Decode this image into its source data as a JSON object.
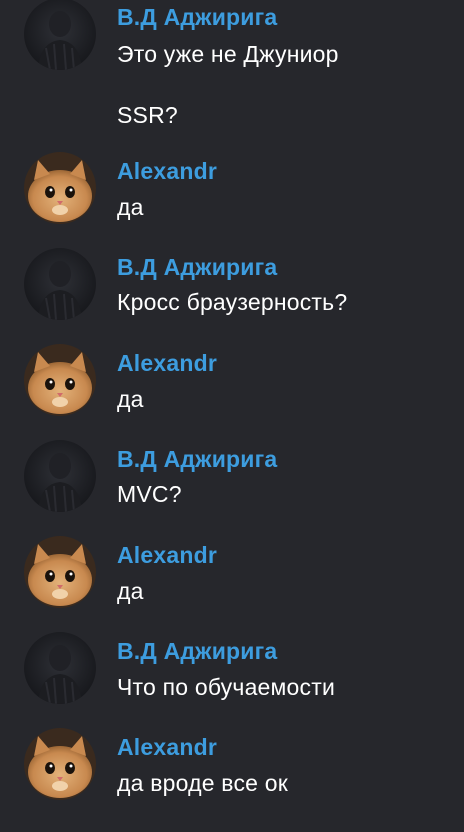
{
  "messages": [
    {
      "author": "В.Д Аджирига",
      "avatar": "dark-figure",
      "lines": [
        "Это уже не Джуниор",
        "SSR?"
      ]
    },
    {
      "author": "Alexandr",
      "avatar": "cat",
      "lines": [
        "да"
      ]
    },
    {
      "author": "В.Д Аджирига",
      "avatar": "dark-figure",
      "lines": [
        "Кросс браузерность?"
      ]
    },
    {
      "author": "Alexandr",
      "avatar": "cat",
      "lines": [
        "да"
      ]
    },
    {
      "author": "В.Д Аджирига",
      "avatar": "dark-figure",
      "lines": [
        "MVC?"
      ]
    },
    {
      "author": "Alexandr",
      "avatar": "cat",
      "lines": [
        "да"
      ]
    },
    {
      "author": "В.Д Аджирига",
      "avatar": "dark-figure",
      "lines": [
        "Что по обучаемости"
      ]
    },
    {
      "author": "Alexandr",
      "avatar": "cat",
      "lines": [
        "да вроде все ок"
      ]
    }
  ],
  "colors": {
    "background": "#26272c",
    "author": "#3d9ddf",
    "text": "#ffffff"
  }
}
